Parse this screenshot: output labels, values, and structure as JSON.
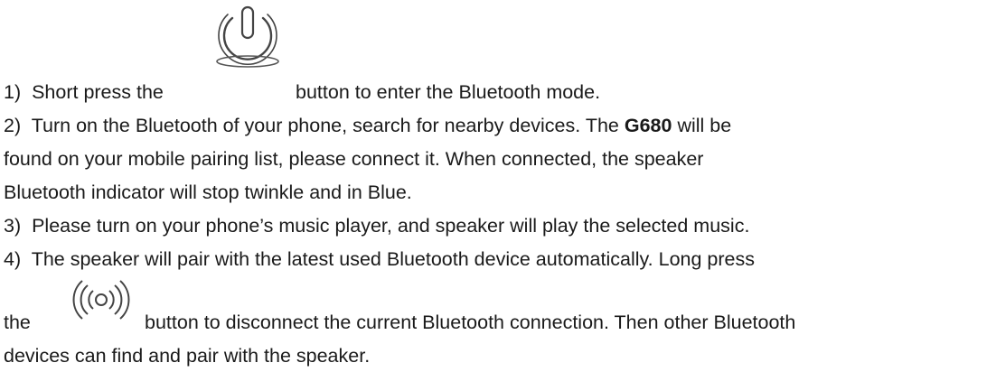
{
  "steps": [
    {
      "number": "1)",
      "before": "Short press the",
      "icon": "power-button-icon",
      "after": "button to enter the Bluetooth mode."
    },
    {
      "number": "2)",
      "text_before": "Turn on the Bluetooth of your phone, search for nearby devices. The",
      "model": "G680",
      "text_after": "will be",
      "line2": "found on your mobile pairing list, please connect it. When connected, the speaker",
      "line3": "Bluetooth indicator will stop twinkle and in Blue."
    },
    {
      "number": "3)",
      "text": "Please turn on your phone’s music player, and speaker will play the selected music."
    },
    {
      "number": "4)",
      "line1": "The speaker will pair with the latest used Bluetooth device automatically. Long press",
      "line2_before": "the",
      "icon": "bluetooth-pairing-button-icon",
      "line2_after": "button to disconnect the current Bluetooth connection. Then other Bluetooth",
      "line3": "devices can find and pair with the speaker."
    }
  ]
}
